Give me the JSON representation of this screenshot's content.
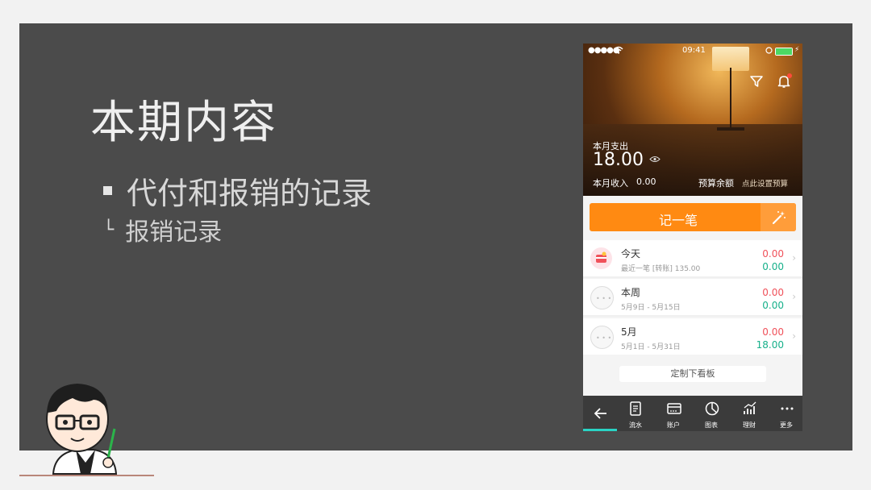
{
  "slide": {
    "title": "本期内容",
    "bullet": "代付和报销的记录",
    "sub_mark": "└",
    "sub_item": "报销记录"
  },
  "phone": {
    "status": {
      "signal": "●●●●●",
      "time": "09:41",
      "battery_color": "#4cd964",
      "bolt": "⚡"
    },
    "header": {
      "expense_label": "本月支出",
      "expense_value": "18.00",
      "income_label": "本月收入",
      "income_value": "0.00",
      "budget_label": "预算余额",
      "budget_link": "点此设置预算"
    },
    "record_button": "记一笔",
    "rows": [
      {
        "title": "今天",
        "subtitle": "最近一笔 [转账] 135.00",
        "expense": "0.00",
        "income": "0.00"
      },
      {
        "title": "本周",
        "subtitle": "5月9日 - 5月15日",
        "expense": "0.00",
        "income": "0.00"
      },
      {
        "title": "5月",
        "subtitle": "5月1日 - 5月31日",
        "expense": "0.00",
        "income": "18.00"
      }
    ],
    "customize_button": "定制下看板",
    "tabs": [
      "流水",
      "账户",
      "图表",
      "理财",
      "更多"
    ],
    "colors": {
      "accent": "#ff8a12",
      "expense": "#f0515a",
      "income": "#16b08a",
      "tab_active": "#2ad3c4"
    }
  }
}
